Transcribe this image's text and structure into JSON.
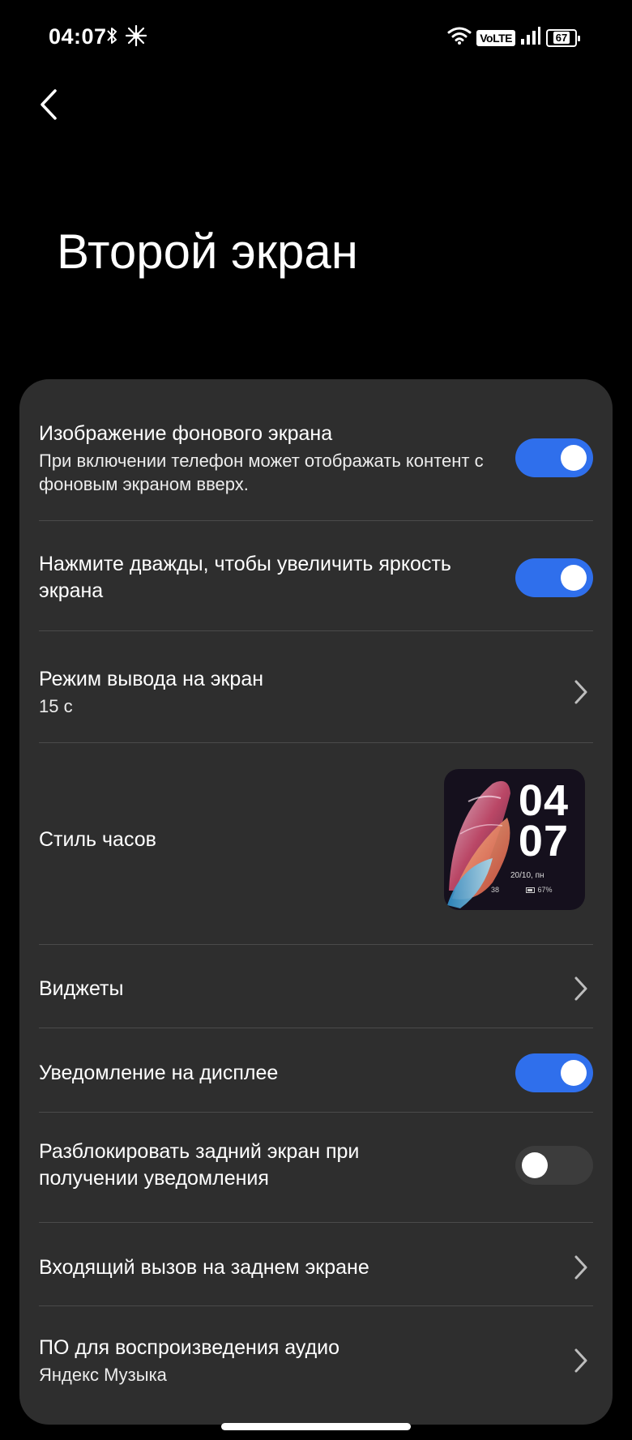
{
  "status_bar": {
    "time": "04:07",
    "network_badge": "VoLTE",
    "battery_level": "67",
    "icons": [
      "bluetooth-icon",
      "sparkle-icon",
      "wifi-icon",
      "signal-icon",
      "battery-icon"
    ]
  },
  "header": {
    "title": "Второй экран"
  },
  "settings": [
    {
      "title": "Изображение фонового экрана",
      "subtitle": "При включении телефон может отображать контент с фоновым экраном вверх.",
      "control": "toggle",
      "state": true
    },
    {
      "title": "Нажмите дважды, чтобы увеличить яркость экрана",
      "control": "toggle",
      "state": true
    },
    {
      "title": "Режим вывода на экран",
      "value": "15 с",
      "control": "chevron"
    },
    {
      "title": "Стиль часов",
      "control": "preview",
      "preview": {
        "hours": "04",
        "minutes": "07",
        "date": "20/10,  пн",
        "steps": "38",
        "battery": "67%"
      }
    },
    {
      "title": "Виджеты",
      "control": "chevron"
    },
    {
      "title": "Уведомление на дисплее",
      "control": "toggle",
      "state": true
    },
    {
      "title": "Разблокировать задний экран при получении уведомления",
      "control": "toggle",
      "state": false
    },
    {
      "title": "Входящий вызов на заднем экране",
      "control": "chevron"
    },
    {
      "title": "ПО для воспроизведения аудио",
      "value": "Яндекс Музыка",
      "control": "chevron"
    }
  ],
  "colors": {
    "accent": "#2f6fec",
    "card_background": "#2e2e2e",
    "page_background": "#000000"
  }
}
